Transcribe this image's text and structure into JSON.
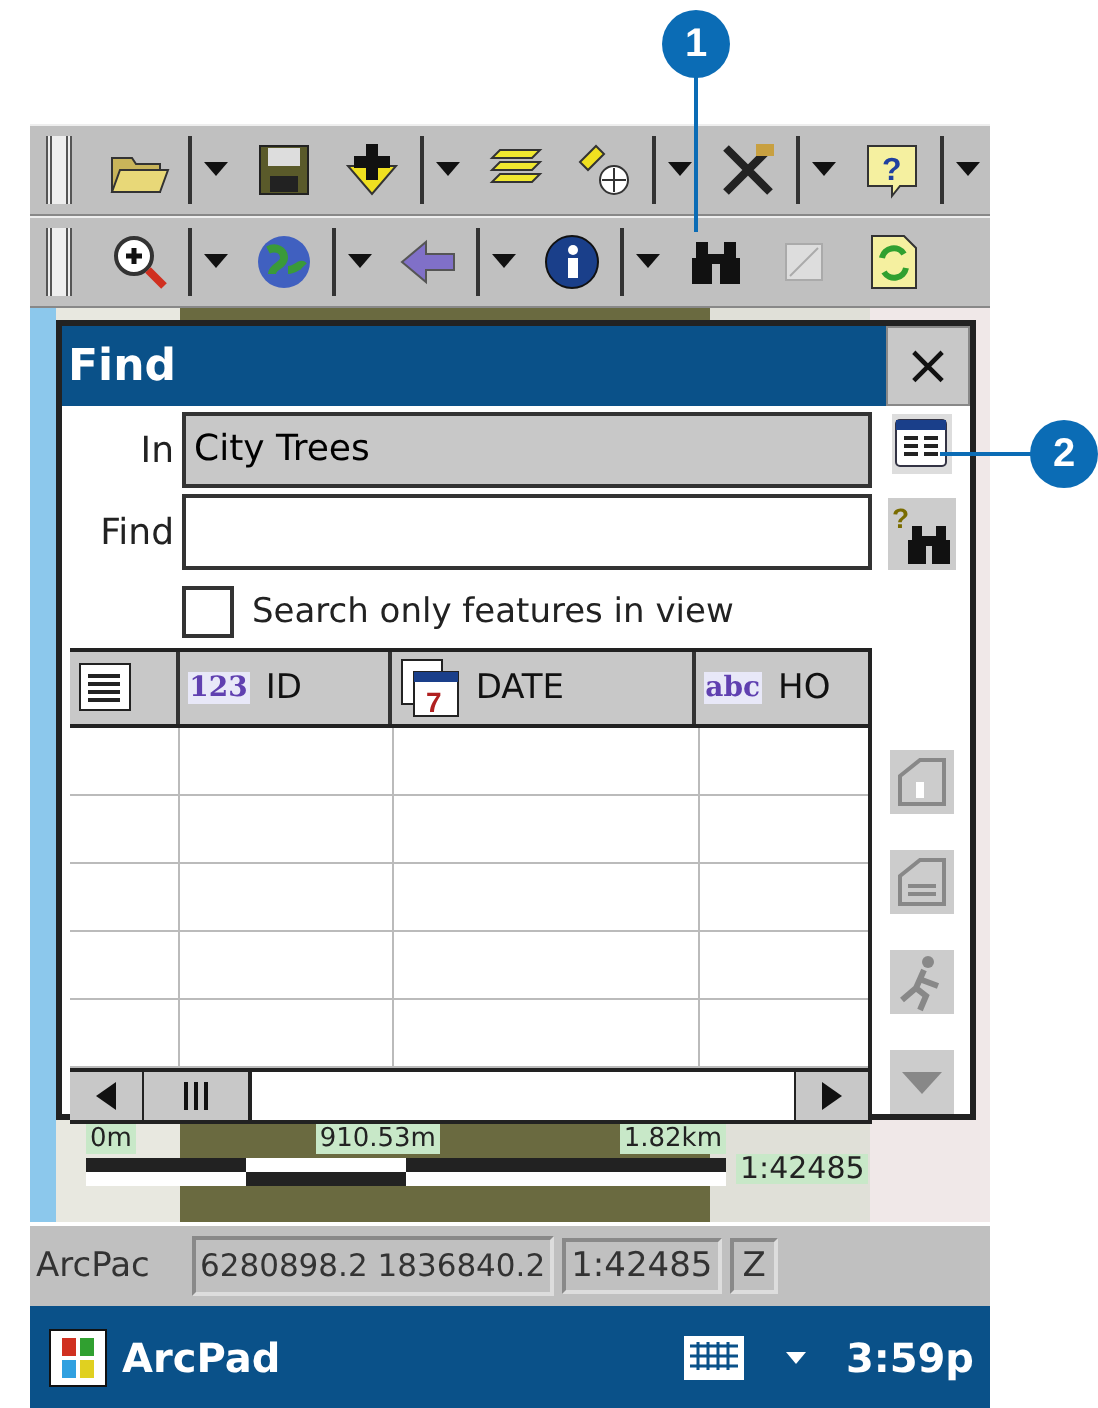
{
  "callouts": [
    "1",
    "2"
  ],
  "toolbars": [
    {
      "items": [
        {
          "kind": "grip"
        },
        {
          "kind": "open"
        },
        {
          "kind": "dropdown"
        },
        {
          "kind": "save"
        },
        {
          "kind": "add"
        },
        {
          "kind": "dropdown"
        },
        {
          "kind": "layers"
        },
        {
          "kind": "gps"
        },
        {
          "kind": "dropdown"
        },
        {
          "kind": "tools"
        },
        {
          "kind": "dropdown"
        },
        {
          "kind": "help",
          "glyph": "?"
        },
        {
          "kind": "dropdown"
        }
      ]
    },
    {
      "items": [
        {
          "kind": "grip"
        },
        {
          "kind": "zoom"
        },
        {
          "kind": "dropdown"
        },
        {
          "kind": "globe"
        },
        {
          "kind": "dropdown"
        },
        {
          "kind": "back"
        },
        {
          "kind": "dropdown"
        },
        {
          "kind": "info"
        },
        {
          "kind": "dropdown"
        },
        {
          "kind": "find"
        },
        {
          "kind": "blank"
        },
        {
          "kind": "refresh"
        }
      ]
    }
  ],
  "dialog": {
    "title": "Find",
    "close": "×",
    "in_label": "In",
    "in_value": "City Trees",
    "find_label": "Find",
    "find_tool_glyph": "?",
    "checkbox": {
      "label": "Search only features in view",
      "checked": false
    },
    "columns": [
      {
        "kind": "index"
      },
      {
        "kind": "number",
        "badge": "123",
        "label": "ID"
      },
      {
        "kind": "date",
        "glyph": "7",
        "label": "DATE"
      },
      {
        "kind": "text",
        "badge": "abc",
        "label": "HO"
      }
    ],
    "side_buttons": [
      {
        "kind": "identify"
      },
      {
        "kind": "attributes"
      },
      {
        "kind": "goto"
      },
      {
        "kind": "more"
      }
    ]
  },
  "map": {
    "scale_labels": [
      "0m",
      "910.53m",
      "1.82km"
    ],
    "scale": "1:42485"
  },
  "status_bar": {
    "app": "ArcPac",
    "coordinates": "6280898.2 1836840.2",
    "scale": "1:42485",
    "button": "Z"
  },
  "taskbar": {
    "app": "ArcPad",
    "time": "3:59p"
  }
}
